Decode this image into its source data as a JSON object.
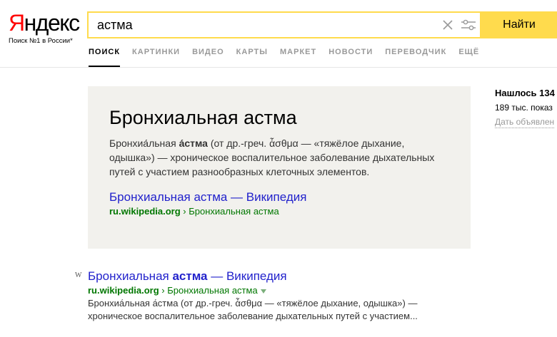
{
  "logo": {
    "first_letter": "Я",
    "rest": "ндекс",
    "slogan": "Поиск №1 в России*"
  },
  "search": {
    "query": "астма",
    "button_label": "Найти"
  },
  "nav": {
    "items": [
      {
        "label": "Поиск"
      },
      {
        "label": "Картинки"
      },
      {
        "label": "Видео"
      },
      {
        "label": "Карты"
      },
      {
        "label": "Маркет"
      },
      {
        "label": "Новости"
      },
      {
        "label": "Переводчик"
      },
      {
        "label": "Ещё"
      }
    ]
  },
  "fact": {
    "title": "Бронхиальная астма",
    "text_prefix": "Бронхиа́льная ",
    "text_bold": "а́стма",
    "text_rest": " (от др.-греч. ἆσθμα — «тяжёлое дыхание, одышка») — хроническое воспалительное заболевание дыхательных путей с участием разнообразных клеточных элементов.",
    "link_title": "Бронхиальная астма — Википедия",
    "domain": "ru.wikipedia.org",
    "path_sep": " › ",
    "path_tail": "Бронхиальная астма"
  },
  "stats": {
    "found": "Нашлось 134",
    "shows": "189 тыс. показ",
    "ad": "Дать объявлен"
  },
  "result": {
    "favicon": "W",
    "title_pre": "Бронхиальная ",
    "title_bold": "астма",
    "title_post": " — Википедия",
    "domain": "ru.wikipedia.org",
    "path_sep": " › ",
    "path_tail": "Бронхиальная астма",
    "snippet": "Бронхиа́льная а́стма (от др.-греч. ἆσθμα — «тяжёлое дыхание, одышка») — хроническое воспалительное заболевание дыхательных путей с участием..."
  }
}
